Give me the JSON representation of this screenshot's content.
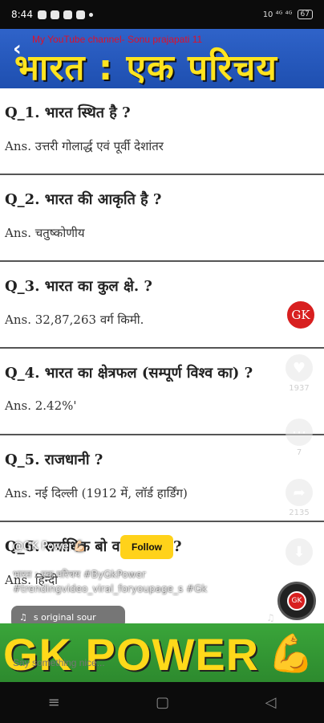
{
  "status_bar": {
    "time": "8:44",
    "right_indicators": "10 ⁴ᴳ ⁴ᴳ",
    "battery": "67"
  },
  "video": {
    "channel_text": "My YouTube channel- Sonu prajapati 11",
    "title": "भारत : एक परिचय",
    "qa": [
      {
        "q": "Q_1.  भारत स्थित है ?",
        "a": "Ans.  उत्तरी गोलार्द्ध एवं पूर्वी देशांतर"
      },
      {
        "q": "Q_2.  भारत की आकृति है ?",
        "a": "Ans.  चतुष्कोणीय"
      },
      {
        "q": "Q_3.  भारत का कुल क्षे. ?",
        "a": "Ans.  32,87,263 वर्ग किमी."
      },
      {
        "q": "Q_4.  भारत का क्षेत्रफल (सम्पूर्ण विश्व का) ?",
        "a": "Ans.  2.42%'"
      },
      {
        "q": "Q_5.  राजधानी ?",
        "a": "Ans.  नई दिल्ली (1912 में, लॉर्ड हार्डिंग)"
      },
      {
        "q": "Q_6.  सर्वाधिक बो        वाली भाषा ?",
        "a": "Ans.  हिन्दी"
      }
    ],
    "gk_badge": "GK",
    "banner_text": "GK POWER"
  },
  "rail": {
    "like_count": "1937",
    "comment_count": "7",
    "share_count": "2135",
    "disc_label": "GK"
  },
  "overlay": {
    "username": "@GK Power💪🏻",
    "follow_label": "Follow",
    "caption": "भारत : एक परिचय #ByGkPower",
    "hashtags": "#trendingvideo_viral_foryoupage_s #Gk",
    "sound": "s original sour",
    "comment_placeholder": "Say something nice..."
  },
  "icons": {
    "back": "back-arrow-icon",
    "like": "heart-icon",
    "comment": "comment-icon",
    "share": "share-icon",
    "download": "download-icon",
    "music": "music-note-icon",
    "nav_menu": "menu-icon",
    "nav_home": "home-icon",
    "nav_back": "back-triangle-icon"
  },
  "colors": {
    "accent_yellow": "#ffd21a",
    "title_yellow": "#ffe41f",
    "badge_red": "#d81f1f",
    "header_blue": "#2f63c9",
    "banner_green": "#3aa53a"
  }
}
